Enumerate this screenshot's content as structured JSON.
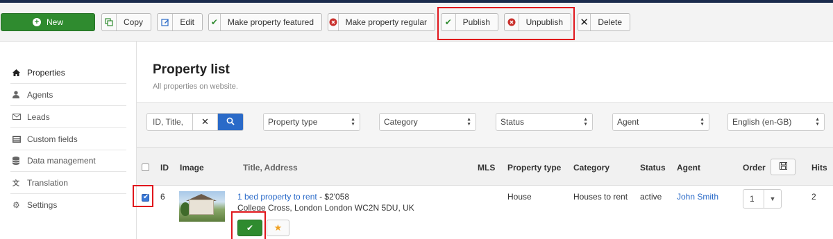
{
  "toolbar": {
    "new_label": "New",
    "copy_label": "Copy",
    "edit_label": "Edit",
    "feature_label": "Make property featured",
    "regular_label": "Make property regular",
    "publish_label": "Publish",
    "unpublish_label": "Unpublish",
    "delete_label": "Delete"
  },
  "sidebar": {
    "items": [
      {
        "label": "Properties",
        "icon": "home-icon"
      },
      {
        "label": "Agents",
        "icon": "user-icon"
      },
      {
        "label": "Leads",
        "icon": "envelope-icon"
      },
      {
        "label": "Custom fields",
        "icon": "list-icon"
      },
      {
        "label": "Data management",
        "icon": "database-icon"
      },
      {
        "label": "Translation",
        "icon": "translate-icon"
      },
      {
        "label": "Settings",
        "icon": "gear-icon"
      }
    ]
  },
  "page": {
    "title": "Property list",
    "subtitle": "All properties on website."
  },
  "filters": {
    "search_placeholder": "ID, Title,",
    "property_type": "Property type",
    "category": "Category",
    "status": "Status",
    "agent": "Agent",
    "language": "English (en-GB)"
  },
  "table": {
    "headers": {
      "id": "ID",
      "image": "Image",
      "title": "Title, Address",
      "mls": "MLS",
      "property_type": "Property type",
      "category": "Category",
      "status": "Status",
      "agent": "Agent",
      "order": "Order",
      "hits": "Hits"
    },
    "rows": [
      {
        "id": "6",
        "title": "1 bed property to rent",
        "price": " - $2'058",
        "address": "College Cross, London London WC2N 5DU, UK",
        "property_type": "House",
        "category": "Houses to rent",
        "status": "active",
        "agent": "John Smith",
        "order": "1",
        "hits": "2",
        "checked": true
      }
    ]
  },
  "colors": {
    "accent": "#2a6ac8",
    "new_button": "#2f8b2f",
    "highlight": "#e0161c"
  }
}
